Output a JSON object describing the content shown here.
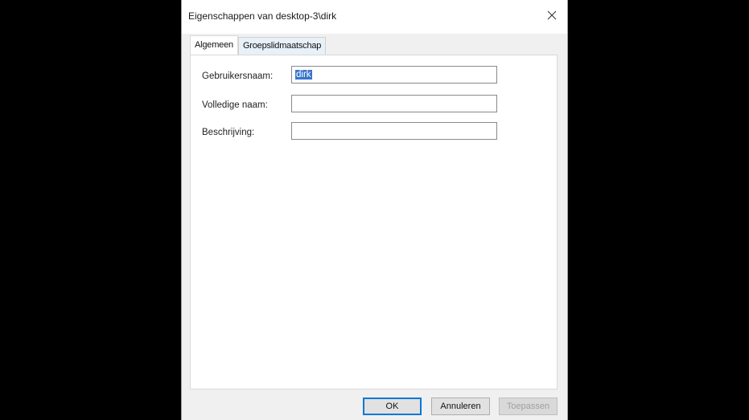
{
  "window": {
    "title": "Eigenschappen van desktop-3\\dirk"
  },
  "tabs": [
    {
      "label": "Algemeen",
      "active": true
    },
    {
      "label": "Groepslidmaatschap",
      "active": false
    }
  ],
  "form": {
    "username": {
      "label": "Gebruikersnaam:",
      "value": "dirk"
    },
    "fullname": {
      "label": "Volledige naam:",
      "value": ""
    },
    "description": {
      "label": "Beschrijving:",
      "value": ""
    }
  },
  "buttons": {
    "ok": "OK",
    "cancel": "Annuleren",
    "apply": "Toepassen"
  },
  "colors": {
    "background": "#000000",
    "dialog": "#f0f0f0",
    "selection": "#3874cb",
    "default_button_border": "#0078d7"
  },
  "icons": {
    "close": "close-icon"
  }
}
